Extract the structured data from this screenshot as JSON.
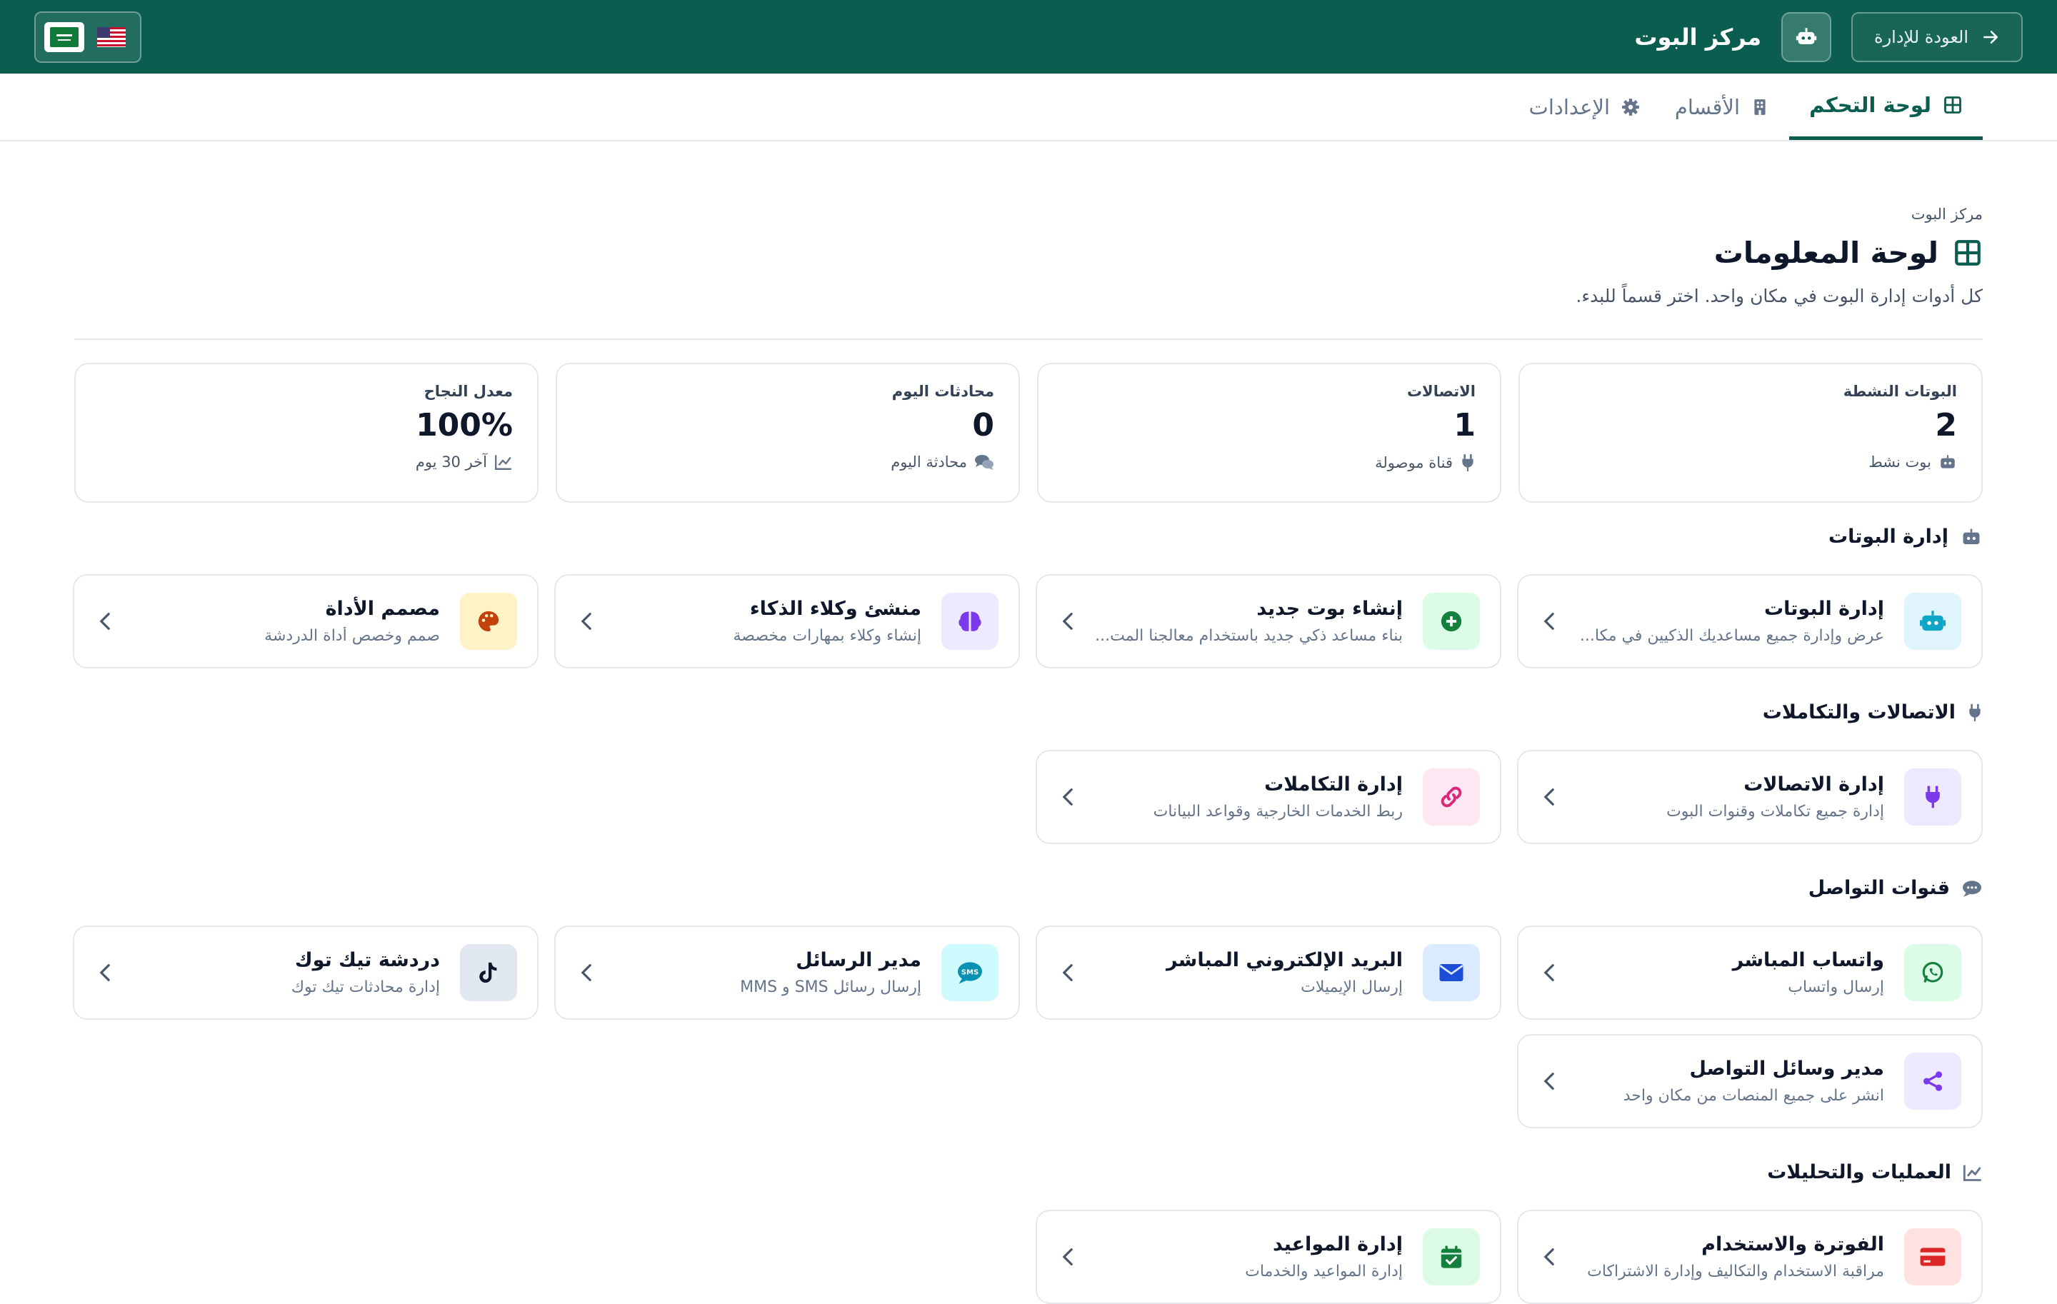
{
  "header": {
    "back_label": "العودة للإدارة",
    "app_title": "مركز البوت",
    "color": "#0b5d4f"
  },
  "tabs": [
    {
      "label": "لوحة التحكم",
      "active": true
    },
    {
      "label": "الأقسام",
      "active": false
    },
    {
      "label": "الإعدادات",
      "active": false
    }
  ],
  "page": {
    "breadcrumb": "مركز البوت",
    "title": "لوحة المعلومات",
    "subtitle": "كل أدوات إدارة البوت في مكان واحد. اختر قسماً للبدء."
  },
  "stats": [
    {
      "label": "البوتات النشطة",
      "value": "2",
      "foot": "بوت نشط",
      "icon": "robot-icon"
    },
    {
      "label": "الاتصالات",
      "value": "1",
      "foot": "قناة موصولة",
      "icon": "plug-icon"
    },
    {
      "label": "محادثات اليوم",
      "value": "0",
      "foot": "محادثة اليوم",
      "icon": "comments-icon"
    },
    {
      "label": "معدل النجاح",
      "value": "100%",
      "foot": "آخر 30 يوم",
      "icon": "chart-line-icon"
    }
  ],
  "sections": {
    "bots": {
      "title": "إدارة البوتات",
      "cards": [
        {
          "title": "إدارة البوتات",
          "desc": "عرض وإدارة جميع مساعديك الذكيين في مكا...",
          "icon": "robot-icon",
          "bg": "#dff4fb",
          "fg": "#0ea5c6"
        },
        {
          "title": "إنشاء بوت جديد",
          "desc": "بناء مساعد ذكي جديد باستخدام معالجنا المت...",
          "icon": "plus-circle-icon",
          "bg": "#dcfce7",
          "fg": "#15803d"
        },
        {
          "title": "منشئ وكلاء الذكاء",
          "desc": "إنشاء وكلاء بمهارات مخصصة",
          "icon": "brain-icon",
          "bg": "#ede9fe",
          "fg": "#7c3aed"
        },
        {
          "title": "مصمم الأداة",
          "desc": "صمم وخصص أداة الدردشة",
          "icon": "palette-icon",
          "bg": "#fef3c7",
          "fg": "#c2410c"
        }
      ]
    },
    "connections": {
      "title": "الاتصالات والتكاملات",
      "cards": [
        {
          "title": "إدارة الاتصالات",
          "desc": "إدارة جميع تكاملات وقنوات البوت",
          "icon": "plug-icon",
          "bg": "#ede9fe",
          "fg": "#7c3aed"
        },
        {
          "title": "إدارة التكاملات",
          "desc": "ربط الخدمات الخارجية وقواعد البيانات",
          "icon": "link-icon",
          "bg": "#fce7f3",
          "fg": "#db2777"
        }
      ]
    },
    "channels": {
      "title": "قنوات التواصل",
      "cards": [
        {
          "title": "واتساب المباشر",
          "desc": "إرسال واتساب",
          "icon": "whatsapp-icon",
          "bg": "#dcfce7",
          "fg": "#15803d"
        },
        {
          "title": "البريد الإلكتروني المباشر",
          "desc": "إرسال الإيميلات",
          "icon": "envelope-icon",
          "bg": "#dbeafe",
          "fg": "#1d4ed8"
        },
        {
          "title": "مدير الرسائل",
          "desc": "إرسال رسائل SMS و MMS",
          "icon": "sms-icon",
          "bg": "#cffafe",
          "fg": "#0891b2"
        },
        {
          "title": "دردشة تيك توك",
          "desc": "إدارة محادثات تيك توك",
          "icon": "tiktok-icon",
          "bg": "#e2e8f0",
          "fg": "#0f172a"
        },
        {
          "title": "مدير وسائل التواصل",
          "desc": "انشر على جميع المنصات من مكان واحد",
          "icon": "share-icon",
          "bg": "#ede9fe",
          "fg": "#7c3aed"
        }
      ]
    },
    "operations": {
      "title": "العمليات والتحليلات",
      "cards": [
        {
          "title": "الفوترة والاستخدام",
          "desc": "مراقبة الاستخدام والتكاليف وإدارة الاشتراكات",
          "icon": "credit-card-icon",
          "bg": "#fee2e2",
          "fg": "#dc2626"
        },
        {
          "title": "إدارة المواعيد",
          "desc": "إدارة المواعيد والخدمات",
          "icon": "calendar-check-icon",
          "bg": "#dcfce7",
          "fg": "#15803d"
        }
      ]
    }
  }
}
